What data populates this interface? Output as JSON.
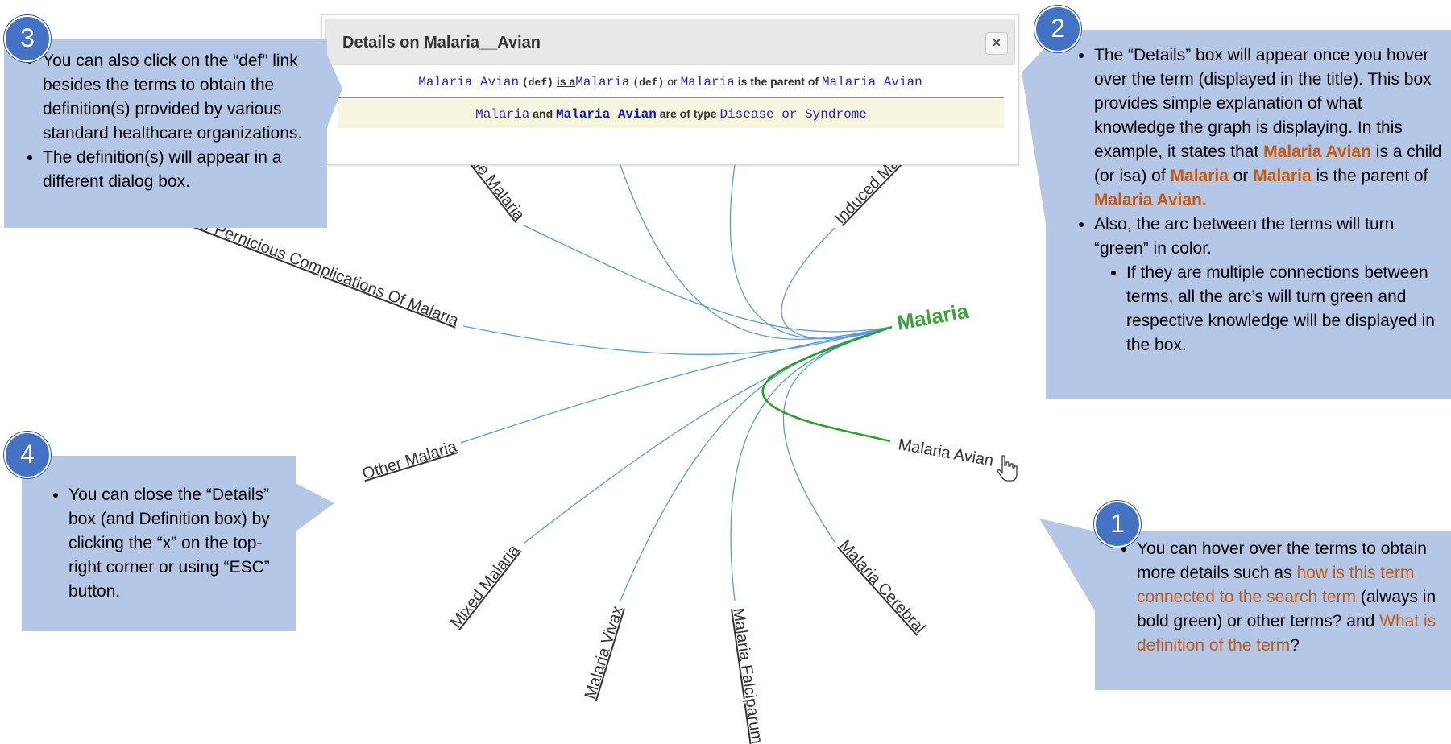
{
  "graph": {
    "center": "Malaria",
    "hovered": "Malaria Avian",
    "nodes": [
      "Ovale Malaria",
      "Induced Malaria",
      "Other Pernicious Complications Of Malaria",
      "Other Malaria",
      "Mixed Malaria",
      "Malaria Vivax",
      "Malaria Falciparum",
      "Malaria Cerebral",
      "Malaria Avian"
    ],
    "colors": {
      "link": "#5b9bd5",
      "active_link": "#2ca02c",
      "center": "#3aa33a"
    }
  },
  "details": {
    "title": "Details on Malaria__Avian",
    "close": "×",
    "child_term": "Malaria Avian",
    "def_link": "(def)",
    "isa": "is a",
    "parent_term": "Malaria",
    "or": "or",
    "parent_term_2": "Malaria",
    "is_parent_text": "is the parent of",
    "child_term_2": "Malaria Avian",
    "type_term1": "Malaria",
    "type_and": "and",
    "type_term2": "Malaria Avian",
    "type_text": "are of type",
    "type_value": "Disease or Syndrome"
  },
  "callouts": {
    "c1": {
      "badge": "1",
      "p1": "You can hover over the terms to obtain more details such as ",
      "p2": "how is this term connected to the search term",
      "p3": " (always in bold green) or other terms? and ",
      "p4": "What is definition of the term",
      "p5": "?"
    },
    "c2": {
      "badge": "2",
      "b1_1": "The “Details” box will appear once you hover over the term (displayed in the title). This box provides simple explanation of what knowledge the graph is displaying. In this example, it states that ",
      "b1_2": "Malaria Avian",
      "b1_3": " is a child (or isa) of ",
      "b1_4": "Malaria",
      "b1_5": " or ",
      "b1_6": "Malaria",
      "b1_7": " is the parent of ",
      "b1_8": "Malaria Avian.",
      "b2": "Also, the arc between the terms will turn “green” in color.",
      "b3": "If they are multiple connections between terms, all the arc’s will turn green and respective knowledge will be displayed in the box."
    },
    "c3": {
      "badge": "3",
      "b1": "You can also click on the “def” link besides the terms to obtain the definition(s) provided by various standard healthcare organizations.",
      "b2": "The definition(s) will appear in a different dialog box."
    },
    "c4": {
      "badge": "4",
      "b1": "You can close the “Details” box (and Definition box) by clicking the “x” on the top-right corner or using “ESC” button."
    }
  }
}
